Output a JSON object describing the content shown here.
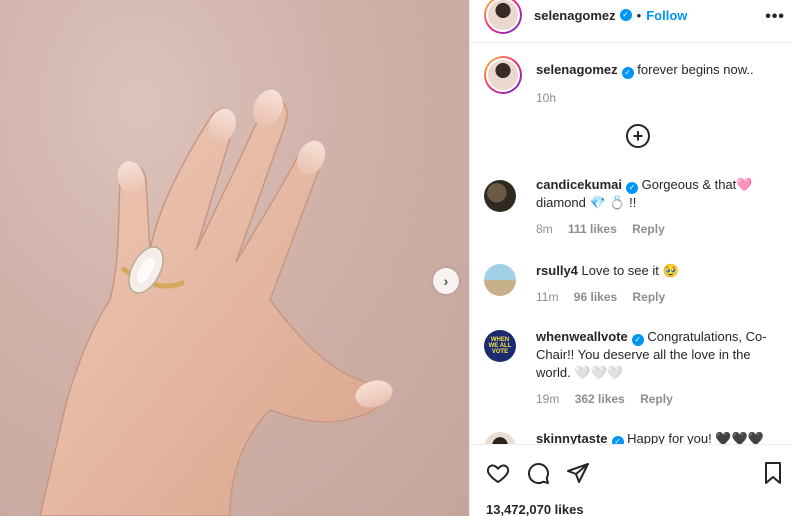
{
  "header": {
    "username": "selenagomez",
    "follow_label": "Follow",
    "more_label": "•••"
  },
  "caption": {
    "username": "selenagomez",
    "text": "forever begins now..",
    "time": "10h"
  },
  "comments": [
    {
      "username": "candicekumai",
      "text": "Gorgeous & that🩷 diamond 💎 💍 !!",
      "time": "8m",
      "likes": "111 likes",
      "reply": "Reply",
      "verified": true
    },
    {
      "username": "rsully4",
      "text": "Love to see it 🥹",
      "time": "11m",
      "likes": "96 likes",
      "reply": "Reply",
      "verified": false
    },
    {
      "username": "whenweallvote",
      "text": "Congratulations, Co-Chair!! You deserve all the love in the world. 🤍🤍🤍",
      "time": "19m",
      "likes": "362 likes",
      "reply": "Reply",
      "verified": true
    },
    {
      "username": "skinnytaste",
      "text": "Happy for you! 🖤🖤🖤",
      "verified": true
    }
  ],
  "post": {
    "likes_count": "13,472,070 likes"
  },
  "colors": {
    "accent": "#0095f6",
    "text": "#262626",
    "muted": "#8e8e8e"
  },
  "icons": [
    "heart-icon",
    "comment-icon",
    "share-icon",
    "bookmark-icon",
    "add-circle-icon",
    "chevron-right-icon",
    "verified-icon"
  ]
}
